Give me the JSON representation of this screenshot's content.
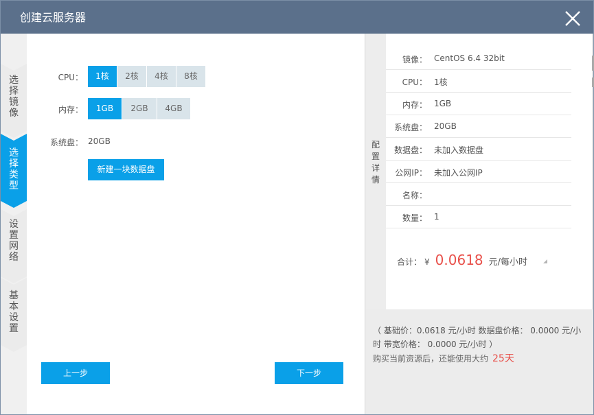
{
  "window": {
    "title": "创建云服务器",
    "close_icon": "close-icon"
  },
  "steps": [
    {
      "label": "选择镜像",
      "active": false
    },
    {
      "label": "选择类型",
      "active": true
    },
    {
      "label": "设置网络",
      "active": false
    },
    {
      "label": "基本设置",
      "active": false
    }
  ],
  "form": {
    "cpu": {
      "label": "CPU：",
      "options": [
        "1核",
        "2核",
        "4核",
        "8核"
      ],
      "selected": "1核"
    },
    "memory": {
      "label": "内存：",
      "options": [
        "1GB",
        "2GB",
        "4GB"
      ],
      "selected": "1GB"
    },
    "system_disk": {
      "label": "系统盘：",
      "value": "20GB"
    },
    "add_disk_button": "新建一块数据盘",
    "prev_button": "上一步",
    "next_button": "下一步"
  },
  "details": {
    "tab_label": "配置详情",
    "rows": [
      {
        "key": "镜像：",
        "value": "CentOS 6.4 32bit"
      },
      {
        "key": "CPU：",
        "value": "1核"
      },
      {
        "key": "内存：",
        "value": "1GB"
      },
      {
        "key": "系统盘：",
        "value": "20GB"
      },
      {
        "key": "数据盘：",
        "value": "未加入数据盘"
      },
      {
        "key": "公网IP：",
        "value": "未加入公网IP"
      },
      {
        "key": "名称：",
        "value": ""
      },
      {
        "key": "数量：",
        "value": "1"
      }
    ],
    "total_label": "合计：",
    "currency": "¥",
    "total_amount": "0.0618",
    "total_unit": "元/每小时"
  },
  "price_info": {
    "line1": "（ 基础价：0.0618 元/小时   数据盘价格： 0.0000 元/小时   带宽价格： 0.0000 元/小时   ）",
    "line2": "购买当前资源后，还能使用大约",
    "days": "25天"
  },
  "colors": {
    "titlebar": "#5b708b",
    "accent": "#0aa0e8",
    "option_bg": "#d9e4ea",
    "price_red": "#e8504a",
    "step_inactive": "#f0f0f0"
  }
}
